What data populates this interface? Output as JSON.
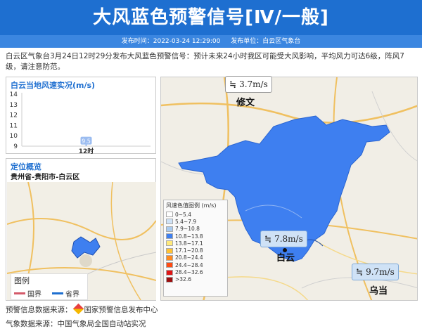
{
  "header": {
    "title": "大风蓝色预警信号[Ⅳ/一般]",
    "publish_time": "发布时间：2022-03-24 12:29:00",
    "publisher": "发布单位：白云区气象台"
  },
  "description": "白云区气象台3月24日12时29分发布大风蓝色预警信号：预计未来24小时我区可能受大风影响，平均风力可达6级，阵风7级，请注意防范。",
  "wind_panel": {
    "title": "白云当地风速实况(m/s)",
    "chart_data": {
      "type": "scatter",
      "categories": [
        "12时"
      ],
      "values": [
        9.5
      ],
      "title": "白云当地风速实况(m/s)",
      "xlabel": "",
      "ylabel": "",
      "ylim": [
        9,
        14
      ],
      "yticks": [
        9,
        10,
        11,
        12,
        13,
        14
      ],
      "data_labels": [
        "9.5"
      ],
      "grid": false
    }
  },
  "location_panel": {
    "title": "定位概览",
    "subtitle": "贵州省-贵阳市-白云区",
    "legend_title": "图例",
    "legend_items": [
      {
        "label": "国界",
        "color": "#d45a6a"
      },
      {
        "label": "省界",
        "color": "#1e6fd0"
      }
    ]
  },
  "big_map": {
    "speed_legend_title": "风速色值图例 (m/s)",
    "speed_legend": [
      {
        "label": "0~5.4",
        "color": "#ffffff"
      },
      {
        "label": "5.4~7.9",
        "color": "#cfe2f6"
      },
      {
        "label": "7.9~10.8",
        "color": "#a9cbf0"
      },
      {
        "label": "10.8~13.8",
        "color": "#3e7ff0"
      },
      {
        "label": "13.8~17.1",
        "color": "#ffe97a"
      },
      {
        "label": "17.1~20.8",
        "color": "#ffc233"
      },
      {
        "label": "20.8~24.4",
        "color": "#ff8a1e"
      },
      {
        "label": "24.4~28.4",
        "color": "#ff4b12"
      },
      {
        "label": "28.4~32.6",
        "color": "#e01515"
      },
      {
        "label": ">32.6",
        "color": "#9c0f0f"
      }
    ],
    "stations": [
      {
        "name": "修文",
        "speed": "3.7m/s"
      },
      {
        "name": "白云",
        "speed": "7.8m/s"
      },
      {
        "name": "乌当",
        "speed": "9.7m/s"
      }
    ]
  },
  "footer": {
    "warning_source": "预警信息数据来源：",
    "warning_source_org": "国家预警信息发布中心",
    "weather_source": "气象数据来源：中国气象局全国自动站实况"
  }
}
